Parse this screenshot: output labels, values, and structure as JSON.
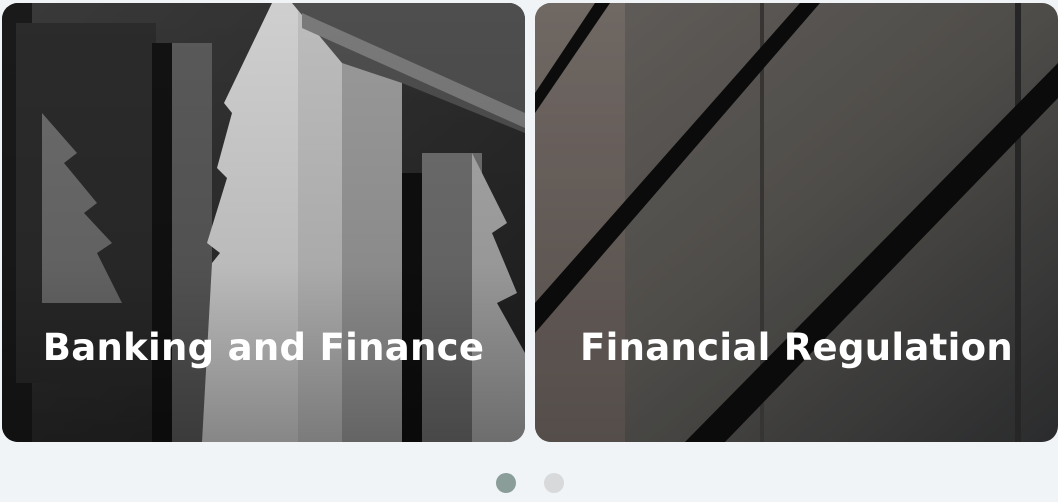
{
  "cards": [
    {
      "title": "Banking and Finance"
    },
    {
      "title": "Financial Regulation"
    }
  ],
  "pagination": {
    "active_color": "#8a9d98",
    "inactive_color": "#d7d9da"
  }
}
